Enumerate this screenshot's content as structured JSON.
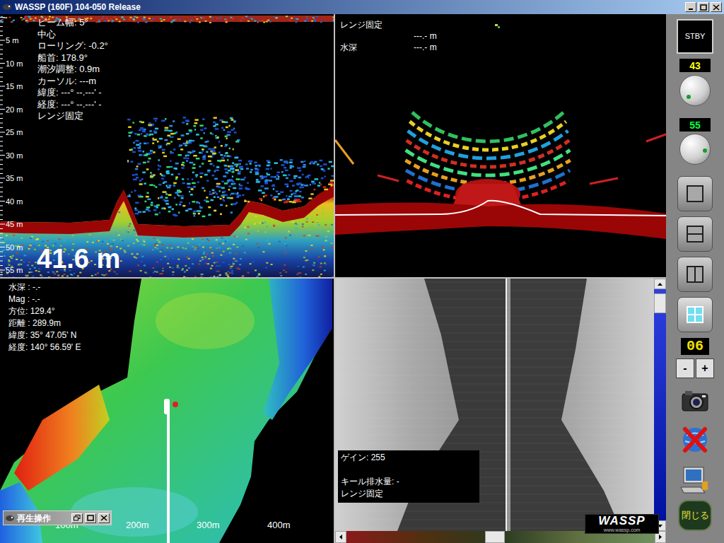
{
  "window": {
    "title": "WASSP (160F) 104-050 Release"
  },
  "echogram": {
    "depth_ticks": [
      "5 m",
      "10 m",
      "15 m",
      "20 m",
      "25 m",
      "30 m",
      "35 m",
      "40 m",
      "45 m",
      "50 m",
      "55 m"
    ],
    "info": [
      "ビーム幅: 5°",
      "中心",
      "ローリング: -0.2°",
      "船首: 178.9°",
      "潮汐調整: 0.9m",
      "カーソル: ---m",
      "緯度: ---° --.---' -",
      "経度: ---° --.---' -",
      "レンジ固定"
    ],
    "depth": "41.6 m"
  },
  "sonar": {
    "range_mode": "レンジ固定",
    "cursor_reading": "---.- m",
    "depth_label": "水深",
    "depth_reading": "---.- m"
  },
  "map": {
    "info": [
      "水深 : -.-",
      "Mag : -.-",
      "方位: 129.4°",
      "距離 : 289.9m",
      "緯度: 35° 47.05' N",
      "経度: 140° 56.59' E"
    ],
    "scale": [
      "100m",
      "200m",
      "300m",
      "400m"
    ]
  },
  "playback_window": {
    "title": "再生操作"
  },
  "sidescan": {
    "gain": "ゲイン: 255",
    "lines": [
      "キール排水量: -",
      "レンジ固定"
    ],
    "scroll": {
      "vertical": 0.02,
      "horizontal": 0.49
    }
  },
  "logo": {
    "name": "WASSP",
    "url": "www.wassp.com"
  },
  "toolbar": {
    "standby": "STBY",
    "knobs": [
      {
        "value": "43",
        "level": 0.02,
        "color": "#ffff00"
      },
      {
        "value": "55",
        "level": 0.85,
        "color": "#00ff40"
      }
    ],
    "layouts": [
      {
        "kind": "single",
        "selected": false
      },
      {
        "kind": "horizontal",
        "selected": false
      },
      {
        "kind": "vertical",
        "selected": false
      },
      {
        "kind": "quad",
        "selected": true
      }
    ],
    "counter": "06",
    "minus": "-",
    "plus": "+",
    "close": "閉じる"
  }
}
